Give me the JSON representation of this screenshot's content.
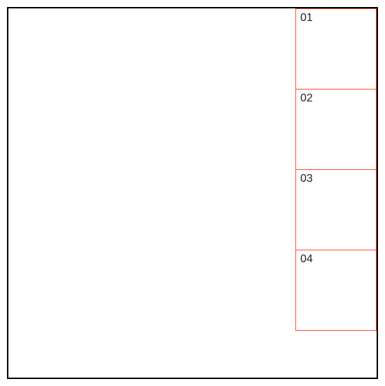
{
  "cells": {
    "0": {
      "label": "01"
    },
    "1": {
      "label": "02"
    },
    "2": {
      "label": "03"
    },
    "3": {
      "label": "04"
    }
  },
  "colors": {
    "outer_border": "#000000",
    "cell_border": "#ff5030",
    "background": "#ffffff",
    "text": "#222222"
  }
}
